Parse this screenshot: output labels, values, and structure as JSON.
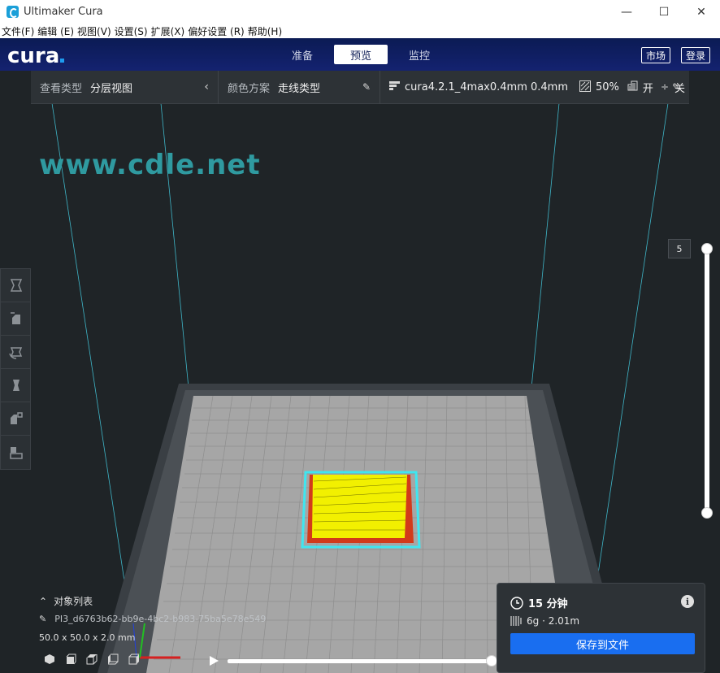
{
  "window": {
    "title": "Ultimaker Cura",
    "controls": {
      "minimize": "—",
      "maximize": "☐",
      "close": "✕"
    }
  },
  "menubar": {
    "items": [
      "文件(F)",
      "编辑 (E)",
      "视图(V)",
      "设置(S)",
      "扩展(X)",
      "偏好设置 (R)",
      "帮助(H)"
    ]
  },
  "header": {
    "logo": "cura",
    "tabs": [
      {
        "label": "准备",
        "active": false
      },
      {
        "label": "预览",
        "active": true
      },
      {
        "label": "监控",
        "active": false
      }
    ],
    "marketplace_label": "市场",
    "signin_label": "登录"
  },
  "toolbar": {
    "view_type_label": "查看类型",
    "view_type_value": "分层视图",
    "color_scheme_label": "颜色方案",
    "color_scheme_value": "走线类型",
    "profile": "cura4.2.1_4max0.4mm 0.4mm",
    "infill": "50%",
    "support": "开",
    "adhesion": "关"
  },
  "watermark": "www.cdle.net",
  "layer_view": {
    "current_layer": "5"
  },
  "object_list": {
    "title": "对象列表",
    "filename": "PI3_d6763b62-bb9e-4bc2-b983-75ba5e78e549",
    "dimensions": "50.0 x 50.0 x 2.0 mm"
  },
  "print_info": {
    "time": "15 分钟",
    "material": "6g · 2.01m",
    "save_button": "保存到文件"
  },
  "colors": {
    "header_bg": "#0b1b54",
    "accent_blue": "#196ef0",
    "viewport_bg": "#1f2427",
    "model_yellow": "#f2f000",
    "travel_cyan": "#3fe6f0"
  }
}
